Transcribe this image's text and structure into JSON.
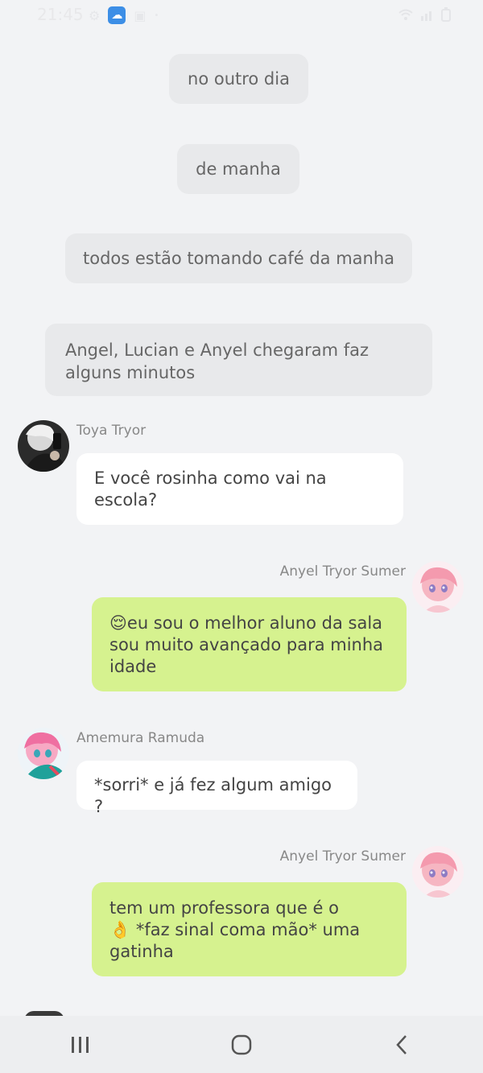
{
  "status_bar": {
    "time": "21:45",
    "icons": [
      "gear-icon",
      "weather-icon",
      "image-icon",
      "dot-icon",
      "wifi-icon",
      "signal-icon",
      "battery-icon"
    ]
  },
  "system_messages": [
    "no outro dia",
    "de manha",
    "todos estão tomando café da manha",
    "Angel, Lucian e Anyel chegaram faz alguns minutos"
  ],
  "messages": [
    {
      "sender": "Toya Tryor",
      "text": "E você rosinha como vai na escola?",
      "side": "left"
    },
    {
      "sender": "Anyel Tryor Sumer",
      "emoji": "😌",
      "text": "eu sou o melhor aluno da sala sou muito avançado para minha idade",
      "side": "right"
    },
    {
      "sender": "Amemura Ramuda",
      "text": "*sorri* e já fez algum amigo ?",
      "side": "left"
    },
    {
      "sender": "Anyel Tryor Sumer",
      "text_before": "tem um professora que é  o",
      "emoji": "👌",
      "text_after": "*faz sinal coma mão* uma gatinha",
      "side": "right"
    }
  ],
  "colors": {
    "background": "#f2f3f5",
    "system_bubble": "#e8e9eb",
    "incoming_bubble": "#ffffff",
    "outgoing_bubble": "#d6f28f"
  },
  "nav_bar": {
    "buttons": [
      "recent-apps",
      "home",
      "back"
    ]
  }
}
